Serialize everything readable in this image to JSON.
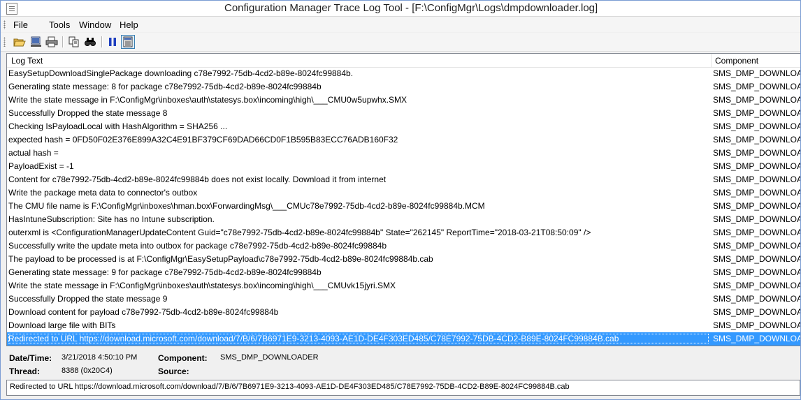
{
  "window": {
    "title": "Configuration Manager Trace Log Tool - [F:\\ConfigMgr\\Logs\\dmpdownloader.log]",
    "app_icon": "log-document-icon"
  },
  "menu": [
    "File",
    "Tools",
    "Window",
    "Help"
  ],
  "toolbar": {
    "icons": [
      "open-folder-icon",
      "print-preview-icon",
      "print-icon",
      "copy-icon",
      "find-icon",
      "pause-icon",
      "toggle-details-icon"
    ]
  },
  "columns": {
    "log_text": "Log Text",
    "component": "Component"
  },
  "rows": [
    {
      "text": "EasySetupDownloadSinglePackage downloading c78e7992-75db-4cd2-b89e-8024fc99884b.",
      "component": "SMS_DMP_DOWNLOADER"
    },
    {
      "text": "Generating state message: 8 for package c78e7992-75db-4cd2-b89e-8024fc99884b",
      "component": "SMS_DMP_DOWNLOADER"
    },
    {
      "text": "Write the state message in F:\\ConfigMgr\\inboxes\\auth\\statesys.box\\incoming\\high\\___CMU0w5upwhx.SMX",
      "component": "SMS_DMP_DOWNLOADER"
    },
    {
      "text": "Successfully Dropped the state message 8",
      "component": "SMS_DMP_DOWNLOADER"
    },
    {
      "text": "Checking IsPayloadLocal with HashAlgorithm = SHA256 ...",
      "component": "SMS_DMP_DOWNLOADER"
    },
    {
      "text": "expected hash = 0FD50F02E376E899A32C4E91BF379CF69DAD66CD0F1B595B83ECC76ADB160F32",
      "component": "SMS_DMP_DOWNLOADER"
    },
    {
      "text": "actual hash =",
      "component": "SMS_DMP_DOWNLOADER"
    },
    {
      "text": "PayloadExist = -1",
      "component": "SMS_DMP_DOWNLOADER"
    },
    {
      "text": "Content for c78e7992-75db-4cd2-b89e-8024fc99884b does not exist locally. Download it from internet",
      "component": "SMS_DMP_DOWNLOADER"
    },
    {
      "text": "Write the package meta data to connector's outbox",
      "component": "SMS_DMP_DOWNLOADER"
    },
    {
      "text": "The CMU file name is F:\\ConfigMgr\\inboxes\\hman.box\\ForwardingMsg\\___CMUc78e7992-75db-4cd2-b89e-8024fc99884b.MCM",
      "component": "SMS_DMP_DOWNLOADER"
    },
    {
      "text": "HasIntuneSubscription: Site has no Intune subscription.",
      "component": "SMS_DMP_DOWNLOADER"
    },
    {
      "text": "outerxml is <ConfigurationManagerUpdateContent Guid=\"c78e7992-75db-4cd2-b89e-8024fc99884b\" State=\"262145\" ReportTime=\"2018-03-21T08:50:09\" />",
      "component": "SMS_DMP_DOWNLOADER"
    },
    {
      "text": "Successfully write the update meta into outbox for package c78e7992-75db-4cd2-b89e-8024fc99884b",
      "component": "SMS_DMP_DOWNLOADER"
    },
    {
      "text": "The payload to be processed is at F:\\ConfigMgr\\EasySetupPayload\\c78e7992-75db-4cd2-b89e-8024fc99884b.cab",
      "component": "SMS_DMP_DOWNLOADER"
    },
    {
      "text": "Generating state message: 9 for package c78e7992-75db-4cd2-b89e-8024fc99884b",
      "component": "SMS_DMP_DOWNLOADER"
    },
    {
      "text": "Write the state message in F:\\ConfigMgr\\inboxes\\auth\\statesys.box\\incoming\\high\\___CMUvk15jyri.SMX",
      "component": "SMS_DMP_DOWNLOADER"
    },
    {
      "text": "Successfully Dropped the state message 9",
      "component": "SMS_DMP_DOWNLOADER"
    },
    {
      "text": "Download content for payload c78e7992-75db-4cd2-b89e-8024fc99884b",
      "component": "SMS_DMP_DOWNLOADER"
    },
    {
      "text": "Download large file with BITs",
      "component": "SMS_DMP_DOWNLOADER"
    },
    {
      "text": "Redirected to URL https://download.microsoft.com/download/7/B/6/7B6971E9-3213-4093-AE1D-DE4F303ED485/C78E7992-75DB-4CD2-B89E-8024FC99884B.cab",
      "component": "SMS_DMP_DOWNLOADER",
      "selected": true
    }
  ],
  "details": {
    "datetime_label": "Date/Time:",
    "datetime_value": "3/21/2018 4:50:10 PM",
    "component_label": "Component:",
    "component_value": "SMS_DMP_DOWNLOADER",
    "thread_label": "Thread:",
    "thread_value": "8388 (0x20C4)",
    "source_label": "Source:",
    "source_value": ""
  },
  "message": "Redirected to URL https://download.microsoft.com/download/7/B/6/7B6971E9-3213-4093-AE1D-DE4F303ED485/C78E7992-75DB-4CD2-B89E-8024FC99884B.cab",
  "colors": {
    "selection": "#3399ff",
    "border": "#828790"
  }
}
